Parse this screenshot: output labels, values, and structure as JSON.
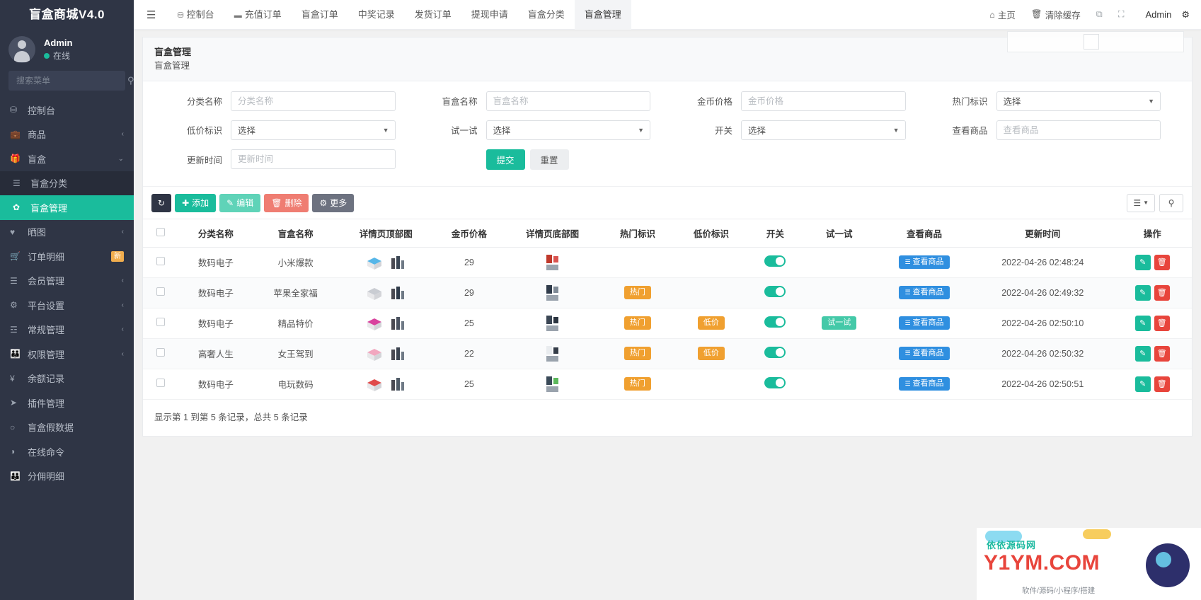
{
  "sidebar": {
    "brand": "盲盒商城V4.0",
    "user": {
      "name": "Admin",
      "status": "在线"
    },
    "search_placeholder": "搜索菜单",
    "items": [
      {
        "label": "控制台",
        "icon": "dashboard-icon",
        "caret": "",
        "sub": false,
        "active": false,
        "badge": ""
      },
      {
        "label": "商品",
        "icon": "bag-icon",
        "caret": "‹",
        "sub": false,
        "active": false,
        "badge": ""
      },
      {
        "label": "盲盒",
        "icon": "box-icon",
        "caret": "⌄",
        "sub": false,
        "active": false,
        "badge": ""
      },
      {
        "label": "盲盒分类",
        "icon": "list-icon",
        "caret": "",
        "sub": true,
        "active": false,
        "badge": ""
      },
      {
        "label": "盲盒管理",
        "icon": "gift-icon",
        "caret": "",
        "sub": true,
        "active": true,
        "badge": ""
      },
      {
        "label": "晒图",
        "icon": "heart-icon",
        "caret": "‹",
        "sub": false,
        "active": false,
        "badge": ""
      },
      {
        "label": "订单明细",
        "icon": "cart-icon",
        "caret": "",
        "sub": false,
        "active": false,
        "badge": "新"
      },
      {
        "label": "会员管理",
        "icon": "users-icon",
        "caret": "‹",
        "sub": false,
        "active": false,
        "badge": ""
      },
      {
        "label": "平台设置",
        "icon": "gear-icon",
        "caret": "‹",
        "sub": false,
        "active": false,
        "badge": ""
      },
      {
        "label": "常规管理",
        "icon": "server-icon",
        "caret": "‹",
        "sub": false,
        "active": false,
        "badge": ""
      },
      {
        "label": "权限管理",
        "icon": "shield-icon",
        "caret": "‹",
        "sub": false,
        "active": false,
        "badge": ""
      },
      {
        "label": "余额记录",
        "icon": "yen-icon",
        "caret": "",
        "sub": false,
        "active": false,
        "badge": ""
      },
      {
        "label": "插件管理",
        "icon": "plugin-icon",
        "caret": "",
        "sub": false,
        "active": false,
        "badge": ""
      },
      {
        "label": "盲盒假数据",
        "icon": "circle-icon",
        "caret": "",
        "sub": false,
        "active": false,
        "badge": ""
      },
      {
        "label": "在线命令",
        "icon": "contrast-icon",
        "caret": "",
        "sub": false,
        "active": false,
        "badge": ""
      },
      {
        "label": "分佣明细",
        "icon": "group-icon",
        "caret": "",
        "sub": false,
        "active": false,
        "badge": ""
      }
    ]
  },
  "topbar": {
    "menu_icon": "hamburger-icon",
    "tabs": [
      {
        "label": "控制台",
        "icon": "dashboard-icon",
        "active": false
      },
      {
        "label": "充值订单",
        "icon": "card-icon",
        "active": false
      },
      {
        "label": "盲盒订单",
        "icon": "",
        "active": false
      },
      {
        "label": "中奖记录",
        "icon": "",
        "active": false
      },
      {
        "label": "发货订单",
        "icon": "",
        "active": false
      },
      {
        "label": "提现申请",
        "icon": "",
        "active": false
      },
      {
        "label": "盲盒分类",
        "icon": "",
        "active": false
      },
      {
        "label": "盲盒管理",
        "icon": "",
        "active": true
      }
    ],
    "right": [
      {
        "label": "主页",
        "icon": "home-icon"
      },
      {
        "label": "清除缓存",
        "icon": "trash-icon"
      },
      {
        "label": "",
        "icon": "copy-icon"
      },
      {
        "label": "",
        "icon": "fullscreen-icon"
      }
    ],
    "user_name": "Admin",
    "settings_icon": "cog-icon"
  },
  "page": {
    "title": "盲盒管理",
    "subtitle": "盲盒管理"
  },
  "filter": {
    "fields": [
      {
        "label": "分类名称",
        "type": "input",
        "value": "",
        "placeholder": "分类名称"
      },
      {
        "label": "盲盒名称",
        "type": "input",
        "value": "",
        "placeholder": "盲盒名称"
      },
      {
        "label": "金币价格",
        "type": "input",
        "value": "",
        "placeholder": "金币价格"
      },
      {
        "label": "热门标识",
        "type": "select",
        "value": "选择",
        "placeholder": ""
      },
      {
        "label": "低价标识",
        "type": "select",
        "value": "选择",
        "placeholder": ""
      },
      {
        "label": "试一试",
        "type": "select",
        "value": "选择",
        "placeholder": ""
      },
      {
        "label": "开关",
        "type": "select",
        "value": "选择",
        "placeholder": ""
      },
      {
        "label": "查看商品",
        "type": "input",
        "value": "",
        "placeholder": "查看商品"
      },
      {
        "label": "更新时间",
        "type": "input",
        "value": "",
        "placeholder": "更新时间"
      }
    ],
    "submit_label": "提交",
    "reset_label": "重置"
  },
  "toolbar": {
    "refresh_icon": "refresh-icon",
    "add_label": "添加",
    "edit_label": "编辑",
    "delete_label": "删除",
    "more_label": "更多",
    "columns_icon": "columns-icon",
    "search_icon": "search-icon"
  },
  "table": {
    "columns": [
      "",
      "分类名称",
      "盲盒名称",
      "详情页顶部图",
      "金币价格",
      "详情页底部图",
      "热门标识",
      "低价标识",
      "开关",
      "试一试",
      "查看商品",
      "更新时间",
      "操作"
    ],
    "rows": [
      {
        "category": "数码电子",
        "name": "小米爆款",
        "price": "29",
        "hot": "",
        "low": "",
        "on": true,
        "try": "",
        "view": "查看商品",
        "updated": "2022-04-26 02:48:24"
      },
      {
        "category": "数码电子",
        "name": "苹果全家福",
        "price": "29",
        "hot": "热门",
        "low": "",
        "on": true,
        "try": "",
        "view": "查看商品",
        "updated": "2022-04-26 02:49:32"
      },
      {
        "category": "数码电子",
        "name": "精品特价",
        "price": "25",
        "hot": "热门",
        "low": "低价",
        "on": true,
        "try": "试一试",
        "view": "查看商品",
        "updated": "2022-04-26 02:50:10"
      },
      {
        "category": "高奢人生",
        "name": "女王驾到",
        "price": "22",
        "hot": "热门",
        "low": "低价",
        "on": true,
        "try": "",
        "view": "查看商品",
        "updated": "2022-04-26 02:50:32"
      },
      {
        "category": "数码电子",
        "name": "电玩数码",
        "price": "25",
        "hot": "热门",
        "low": "",
        "on": true,
        "try": "",
        "view": "查看商品",
        "updated": "2022-04-26 02:50:51"
      }
    ],
    "edit_icon": "pencil-icon",
    "delete_icon": "trash-icon"
  },
  "pager": {
    "text": "显示第 1 到第 5 条记录，总共 5 条记录"
  },
  "watermark": {
    "brand": "依依源码网",
    "domain": "Y1YM.COM",
    "tagline": "软件/源码/小程序/搭建"
  },
  "colors": {
    "accent": "#1abc9c",
    "sidebar": "#2f3545",
    "hot": "#f0a030",
    "view": "#2f8fe0",
    "danger": "#e8453c"
  }
}
